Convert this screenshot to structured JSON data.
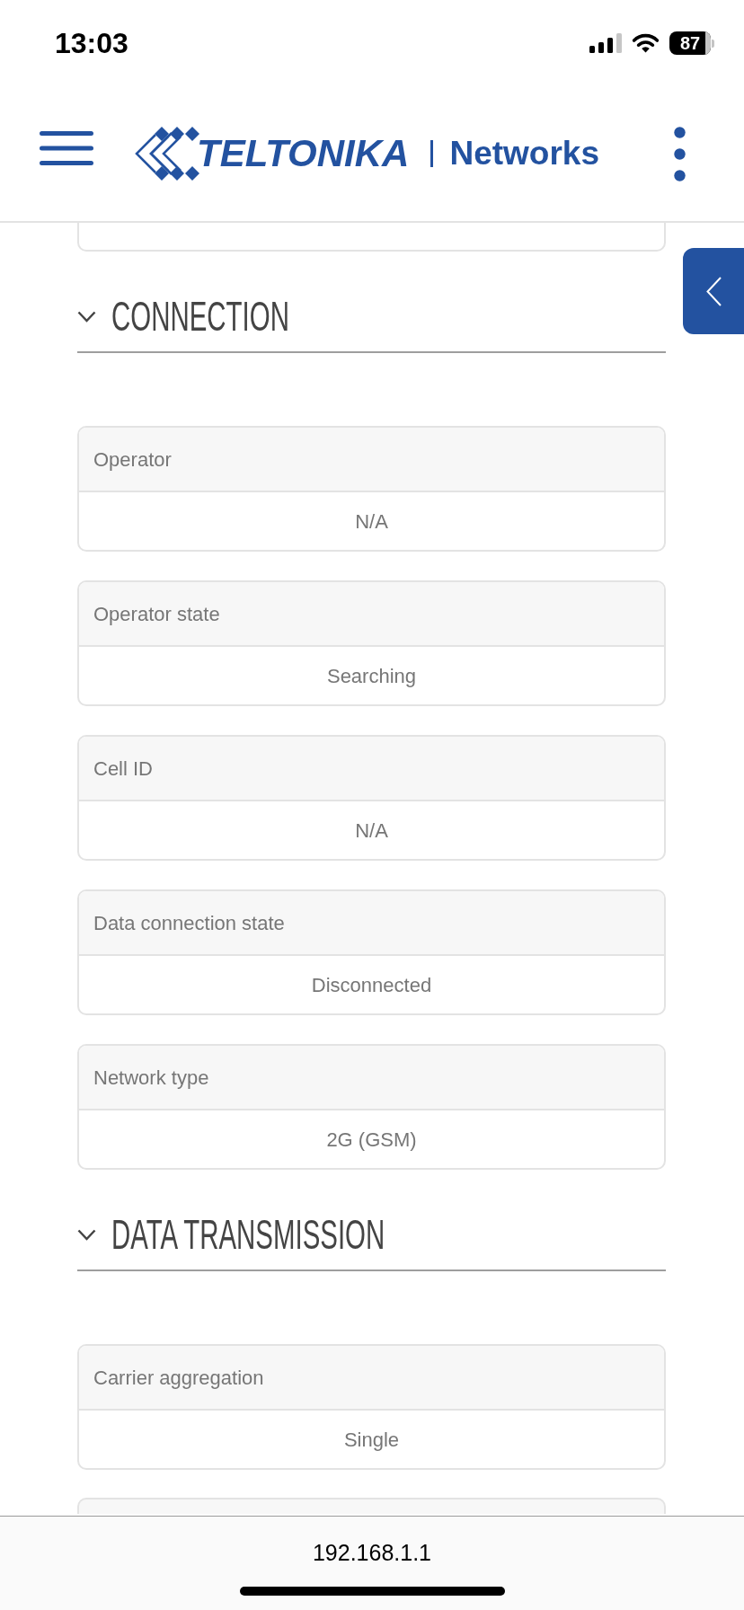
{
  "status_bar": {
    "time": "13:03",
    "battery": "87"
  },
  "header": {
    "brand": "TELTONIKA",
    "product": "Networks"
  },
  "sections": [
    {
      "title": "CONNECTION",
      "expanded": true,
      "fields": [
        {
          "label": "Operator",
          "value": "N/A"
        },
        {
          "label": "Operator state",
          "value": "Searching"
        },
        {
          "label": "Cell ID",
          "value": "N/A"
        },
        {
          "label": "Data connection state",
          "value": "Disconnected"
        },
        {
          "label": "Network type",
          "value": "2G (GSM)"
        }
      ]
    },
    {
      "title": "DATA TRANSMISSION",
      "expanded": true,
      "fields": [
        {
          "label": "Carrier aggregation",
          "value": "Single"
        }
      ]
    }
  ],
  "address_bar": {
    "url": "192.168.1.1"
  }
}
